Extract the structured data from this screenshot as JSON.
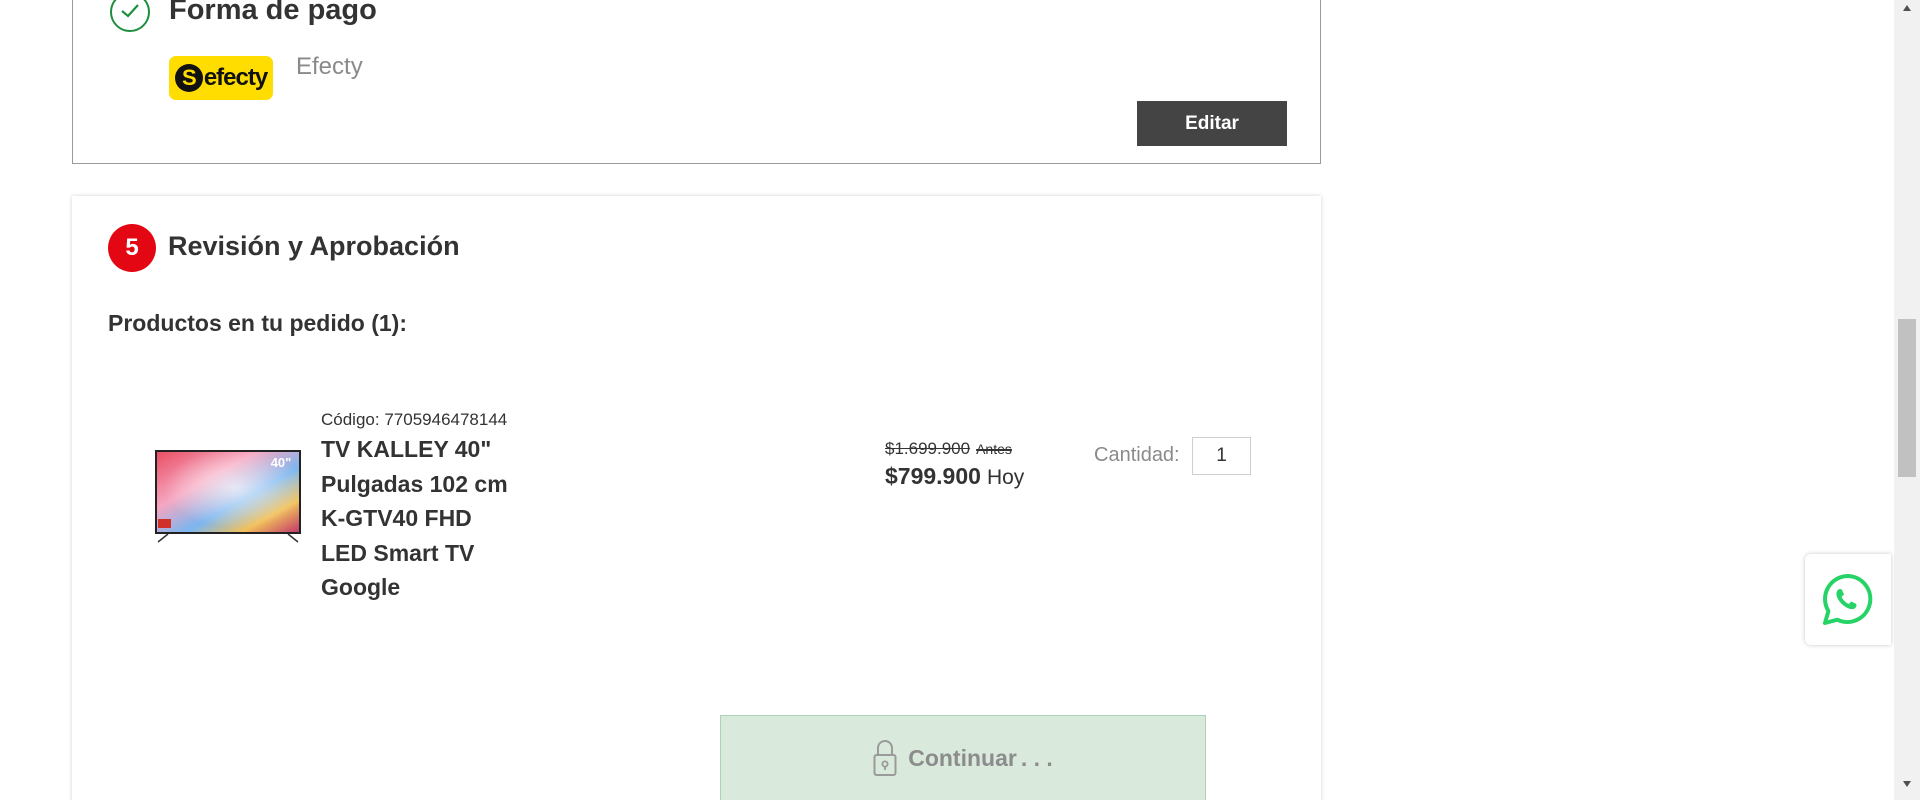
{
  "payment": {
    "title": "Forma de pago",
    "logo_text": "efecty",
    "logo_mark": "S",
    "method_name": "Efecty",
    "edit_label": "Editar",
    "icons": {
      "status": "check-circle-icon"
    },
    "colors": {
      "check": "#1e8e3e",
      "logo_bg": "#ffdd00",
      "edit_bg": "#444444"
    }
  },
  "review": {
    "step_number": "5",
    "title": "Revisión y Aprobación",
    "products_heading": "Productos en tu pedido (1):",
    "colors": {
      "step_badge": "#e30613"
    },
    "product": {
      "image_badge": "40\"",
      "code_label": "Código:",
      "code": "7705946478144",
      "name": "TV KALLEY 40\" Pulgadas 102 cm K-GTV40 FHD LED Smart TV Google",
      "price_old": "$1.699.900",
      "price_old_label": "Antes",
      "price_new": "$799.900",
      "price_new_label": "Hoy",
      "quantity_label": "Cantidad:",
      "quantity": "1"
    },
    "continue_label": "Continuar",
    "continue_dots": ". . .",
    "continue_colors": {
      "bg": "#d9eadc",
      "text": "#8c8c8c"
    },
    "icons": {
      "continue": "lock-icon"
    }
  },
  "whatsapp": {
    "icon": "whatsapp-icon",
    "color": "#25d366"
  }
}
